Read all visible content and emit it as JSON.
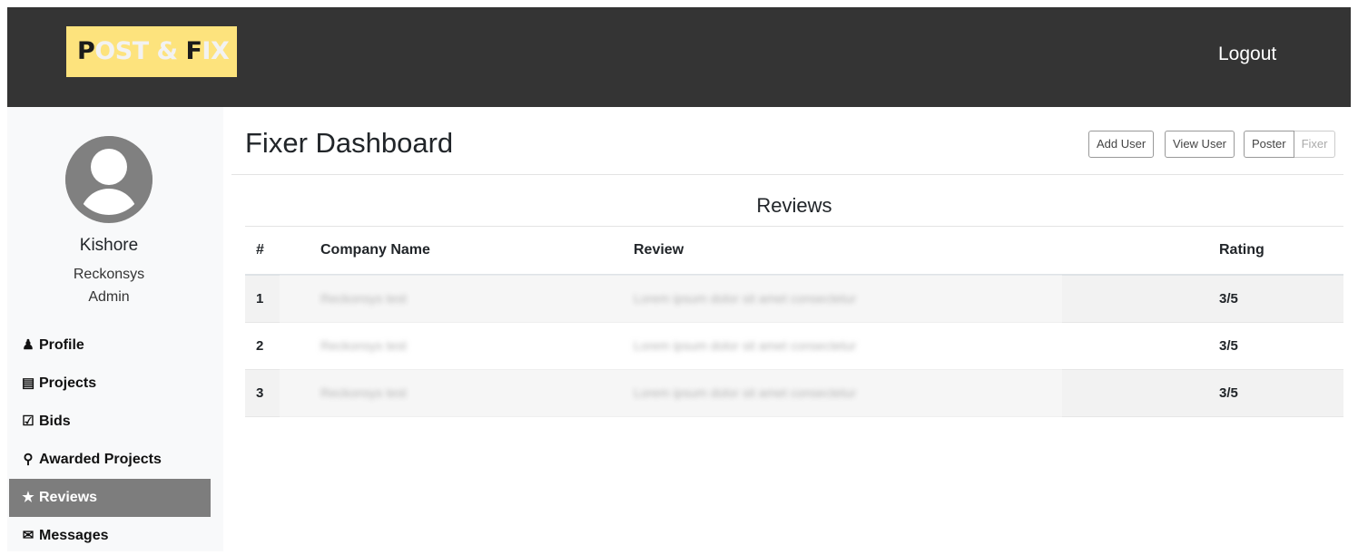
{
  "header": {
    "logo_first_dark": "P",
    "logo_mid": "OST & ",
    "logo_second_dark": "F",
    "logo_end": "IX",
    "logout_label": "Logout"
  },
  "sidebar": {
    "user_name": "Kishore",
    "company": "Reckonsys",
    "role": "Admin",
    "items": [
      {
        "label": "Profile",
        "icon": "user-icon"
      },
      {
        "label": "Projects",
        "icon": "clipboard-list-icon"
      },
      {
        "label": "Bids",
        "icon": "clipboard-check-icon"
      },
      {
        "label": "Awarded Projects",
        "icon": "award-icon"
      },
      {
        "label": "Reviews",
        "icon": "star-icon",
        "active": true
      },
      {
        "label": "Messages",
        "icon": "envelope-icon"
      }
    ]
  },
  "main": {
    "title": "Fixer Dashboard",
    "buttons": {
      "add_user": "Add User",
      "view_user": "View User",
      "poster": "Poster",
      "fixer": "Fixer"
    },
    "reviews_heading": "Reviews",
    "table": {
      "headers": [
        "#",
        "Company Name",
        "Review",
        "Rating"
      ],
      "rows": [
        {
          "num": "1",
          "company": "Reckonsys test",
          "review": "Lorem ipsum dolor sit amet consectetur",
          "rating": "3/5"
        },
        {
          "num": "2",
          "company": "Reckonsys test",
          "review": "Lorem ipsum dolor sit amet consectetur",
          "rating": "3/5"
        },
        {
          "num": "3",
          "company": "Reckonsys test",
          "review": "Lorem ipsum dolor sit amet consectetur",
          "rating": "3/5"
        }
      ]
    }
  },
  "colors": {
    "header_bg": "#343434",
    "logo_bg": "#fde37d",
    "sidebar_bg": "#f8f9fa",
    "active_nav_bg": "#7d7d7d"
  }
}
